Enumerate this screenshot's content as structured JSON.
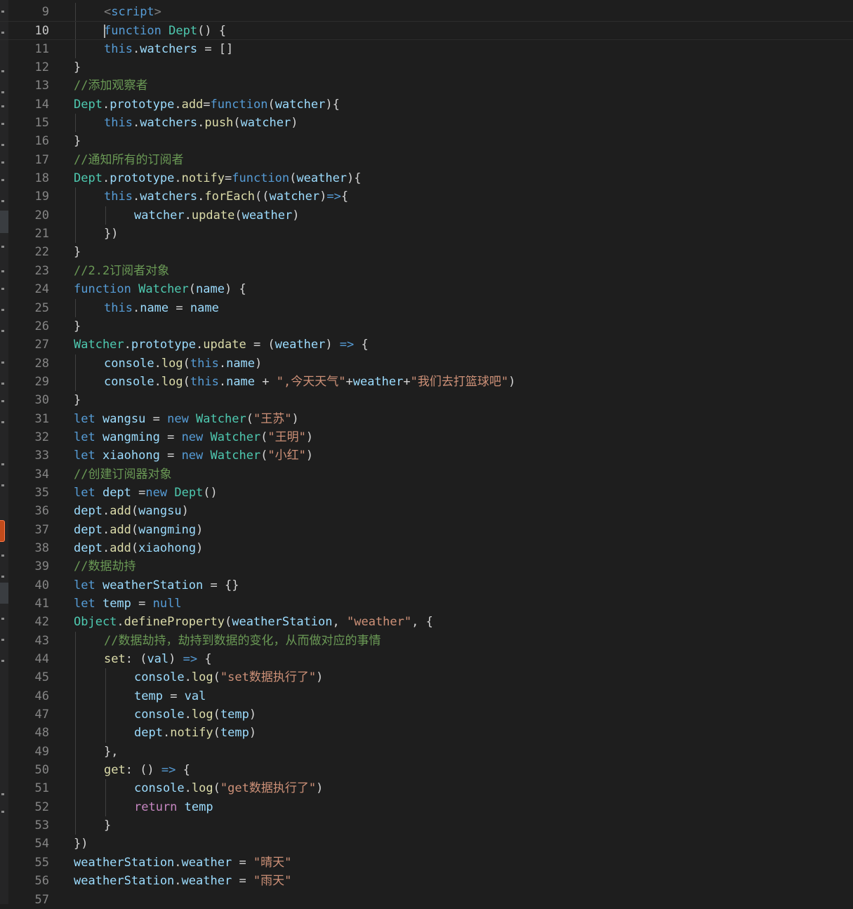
{
  "editor": {
    "first_line": 9,
    "current_line": 10,
    "lines": [
      {
        "n": "9",
        "indent": 1,
        "tokens": [
          [
            "tag",
            "<"
          ],
          [
            "kw",
            "script"
          ],
          [
            "tag",
            ">"
          ]
        ]
      },
      {
        "n": "10",
        "indent": 1,
        "tokens": [
          [
            "kw",
            "function "
          ],
          [
            "type",
            "Dept"
          ],
          [
            "plain",
            "() {"
          ]
        ],
        "current": true
      },
      {
        "n": "11",
        "indent": 1,
        "tokens": [
          [
            "kw",
            "this"
          ],
          [
            "plain",
            "."
          ],
          [
            "var",
            "watchers"
          ],
          [
            "plain",
            " = []"
          ]
        ]
      },
      {
        "n": "12",
        "indent": 0,
        "tokens": [
          [
            "plain",
            "}"
          ]
        ]
      },
      {
        "n": "13",
        "indent": 0,
        "tokens": [
          [
            "cmt",
            "//添加观察者"
          ]
        ]
      },
      {
        "n": "14",
        "indent": 0,
        "tokens": [
          [
            "type",
            "Dept"
          ],
          [
            "plain",
            "."
          ],
          [
            "var",
            "prototype"
          ],
          [
            "plain",
            "."
          ],
          [
            "fn",
            "add"
          ],
          [
            "plain",
            "="
          ],
          [
            "kw",
            "function"
          ],
          [
            "plain",
            "("
          ],
          [
            "var",
            "watcher"
          ],
          [
            "plain",
            "){"
          ]
        ]
      },
      {
        "n": "15",
        "indent": 1,
        "tokens": [
          [
            "kw",
            "this"
          ],
          [
            "plain",
            "."
          ],
          [
            "var",
            "watchers"
          ],
          [
            "plain",
            "."
          ],
          [
            "fn",
            "push"
          ],
          [
            "plain",
            "("
          ],
          [
            "var",
            "watcher"
          ],
          [
            "plain",
            ")"
          ]
        ]
      },
      {
        "n": "16",
        "indent": 0,
        "tokens": [
          [
            "plain",
            "}"
          ]
        ]
      },
      {
        "n": "17",
        "indent": 0,
        "tokens": [
          [
            "cmt",
            "//通知所有的订阅者"
          ]
        ]
      },
      {
        "n": "18",
        "indent": 0,
        "tokens": [
          [
            "type",
            "Dept"
          ],
          [
            "plain",
            "."
          ],
          [
            "var",
            "prototype"
          ],
          [
            "plain",
            "."
          ],
          [
            "fn",
            "notify"
          ],
          [
            "plain",
            "="
          ],
          [
            "kw",
            "function"
          ],
          [
            "plain",
            "("
          ],
          [
            "var",
            "weather"
          ],
          [
            "plain",
            "){"
          ]
        ]
      },
      {
        "n": "19",
        "indent": 1,
        "tokens": [
          [
            "kw",
            "this"
          ],
          [
            "plain",
            "."
          ],
          [
            "var",
            "watchers"
          ],
          [
            "plain",
            "."
          ],
          [
            "fn",
            "forEach"
          ],
          [
            "plain",
            "(("
          ],
          [
            "var",
            "watcher"
          ],
          [
            "plain",
            ")"
          ],
          [
            "kw",
            "=>"
          ],
          [
            "plain",
            "{"
          ]
        ]
      },
      {
        "n": "20",
        "indent": 2,
        "tokens": [
          [
            "var",
            "watcher"
          ],
          [
            "plain",
            "."
          ],
          [
            "fn",
            "update"
          ],
          [
            "plain",
            "("
          ],
          [
            "var",
            "weather"
          ],
          [
            "plain",
            ")"
          ]
        ]
      },
      {
        "n": "21",
        "indent": 1,
        "tokens": [
          [
            "plain",
            "})"
          ]
        ]
      },
      {
        "n": "22",
        "indent": 0,
        "tokens": [
          [
            "plain",
            "}"
          ]
        ]
      },
      {
        "n": "23",
        "indent": 0,
        "tokens": [
          [
            "cmt",
            "//2.2订阅者对象"
          ]
        ]
      },
      {
        "n": "24",
        "indent": 0,
        "tokens": [
          [
            "kw",
            "function "
          ],
          [
            "type",
            "Watcher"
          ],
          [
            "plain",
            "("
          ],
          [
            "var",
            "name"
          ],
          [
            "plain",
            ") {"
          ]
        ]
      },
      {
        "n": "25",
        "indent": 1,
        "tokens": [
          [
            "kw",
            "this"
          ],
          [
            "plain",
            "."
          ],
          [
            "var",
            "name"
          ],
          [
            "plain",
            " = "
          ],
          [
            "var",
            "name"
          ]
        ]
      },
      {
        "n": "26",
        "indent": 0,
        "tokens": [
          [
            "plain",
            "}"
          ]
        ]
      },
      {
        "n": "27",
        "indent": 0,
        "tokens": [
          [
            "type",
            "Watcher"
          ],
          [
            "plain",
            "."
          ],
          [
            "var",
            "prototype"
          ],
          [
            "plain",
            "."
          ],
          [
            "fn",
            "update"
          ],
          [
            "plain",
            " = ("
          ],
          [
            "var",
            "weather"
          ],
          [
            "plain",
            ") "
          ],
          [
            "kw",
            "=>"
          ],
          [
            "plain",
            " {"
          ]
        ]
      },
      {
        "n": "28",
        "indent": 1,
        "tokens": [
          [
            "var",
            "console"
          ],
          [
            "plain",
            "."
          ],
          [
            "fn",
            "log"
          ],
          [
            "plain",
            "("
          ],
          [
            "kw",
            "this"
          ],
          [
            "plain",
            "."
          ],
          [
            "var",
            "name"
          ],
          [
            "plain",
            ")"
          ]
        ]
      },
      {
        "n": "29",
        "indent": 1,
        "tokens": [
          [
            "var",
            "console"
          ],
          [
            "plain",
            "."
          ],
          [
            "fn",
            "log"
          ],
          [
            "plain",
            "("
          ],
          [
            "kw",
            "this"
          ],
          [
            "plain",
            "."
          ],
          [
            "var",
            "name"
          ],
          [
            "plain",
            " + "
          ],
          [
            "str",
            "\",今天天气\""
          ],
          [
            "plain",
            "+"
          ],
          [
            "var",
            "weather"
          ],
          [
            "plain",
            "+"
          ],
          [
            "str",
            "\"我们去打篮球吧\""
          ],
          [
            "plain",
            ")"
          ]
        ]
      },
      {
        "n": "30",
        "indent": 0,
        "tokens": [
          [
            "plain",
            "}"
          ]
        ]
      },
      {
        "n": "31",
        "indent": 0,
        "tokens": [
          [
            "kw",
            "let "
          ],
          [
            "var",
            "wangsu"
          ],
          [
            "plain",
            " = "
          ],
          [
            "kw",
            "new "
          ],
          [
            "type",
            "Watcher"
          ],
          [
            "plain",
            "("
          ],
          [
            "str",
            "\"王苏\""
          ],
          [
            "plain",
            ")"
          ]
        ]
      },
      {
        "n": "32",
        "indent": 0,
        "tokens": [
          [
            "kw",
            "let "
          ],
          [
            "var",
            "wangming"
          ],
          [
            "plain",
            " = "
          ],
          [
            "kw",
            "new "
          ],
          [
            "type",
            "Watcher"
          ],
          [
            "plain",
            "("
          ],
          [
            "str",
            "\"王明\""
          ],
          [
            "plain",
            ")"
          ]
        ]
      },
      {
        "n": "33",
        "indent": 0,
        "tokens": [
          [
            "kw",
            "let "
          ],
          [
            "var",
            "xiaohong"
          ],
          [
            "plain",
            " = "
          ],
          [
            "kw",
            "new "
          ],
          [
            "type",
            "Watcher"
          ],
          [
            "plain",
            "("
          ],
          [
            "str",
            "\"小红\""
          ],
          [
            "plain",
            ")"
          ]
        ]
      },
      {
        "n": "34",
        "indent": 0,
        "tokens": [
          [
            "cmt",
            "//创建订阅器对象"
          ]
        ]
      },
      {
        "n": "35",
        "indent": 0,
        "tokens": [
          [
            "kw",
            "let "
          ],
          [
            "var",
            "dept"
          ],
          [
            "plain",
            " ="
          ],
          [
            "kw",
            "new "
          ],
          [
            "type",
            "Dept"
          ],
          [
            "plain",
            "()"
          ]
        ]
      },
      {
        "n": "36",
        "indent": 0,
        "tokens": [
          [
            "var",
            "dept"
          ],
          [
            "plain",
            "."
          ],
          [
            "fn",
            "add"
          ],
          [
            "plain",
            "("
          ],
          [
            "var",
            "wangsu"
          ],
          [
            "plain",
            ")"
          ]
        ]
      },
      {
        "n": "37",
        "indent": 0,
        "tokens": [
          [
            "var",
            "dept"
          ],
          [
            "plain",
            "."
          ],
          [
            "fn",
            "add"
          ],
          [
            "plain",
            "("
          ],
          [
            "var",
            "wangming"
          ],
          [
            "plain",
            ")"
          ]
        ]
      },
      {
        "n": "38",
        "indent": 0,
        "tokens": [
          [
            "var",
            "dept"
          ],
          [
            "plain",
            "."
          ],
          [
            "fn",
            "add"
          ],
          [
            "plain",
            "("
          ],
          [
            "var",
            "xiaohong"
          ],
          [
            "plain",
            ")"
          ]
        ]
      },
      {
        "n": "39",
        "indent": 0,
        "tokens": [
          [
            "cmt",
            "//数据劫持"
          ]
        ]
      },
      {
        "n": "40",
        "indent": 0,
        "tokens": [
          [
            "kw",
            "let "
          ],
          [
            "var",
            "weatherStation"
          ],
          [
            "plain",
            " = {}"
          ]
        ]
      },
      {
        "n": "41",
        "indent": 0,
        "tokens": [
          [
            "kw",
            "let "
          ],
          [
            "var",
            "temp"
          ],
          [
            "plain",
            " = "
          ],
          [
            "kw",
            "null"
          ]
        ]
      },
      {
        "n": "42",
        "indent": 0,
        "tokens": [
          [
            "type",
            "Object"
          ],
          [
            "plain",
            "."
          ],
          [
            "fn",
            "defineProperty"
          ],
          [
            "plain",
            "("
          ],
          [
            "var",
            "weatherStation"
          ],
          [
            "plain",
            ", "
          ],
          [
            "str",
            "\"weather\""
          ],
          [
            "plain",
            ", {"
          ]
        ]
      },
      {
        "n": "43",
        "indent": 1,
        "tokens": [
          [
            "cmt",
            "//数据劫持，劫持到数据的变化，从而做对应的事情"
          ]
        ]
      },
      {
        "n": "44",
        "indent": 1,
        "tokens": [
          [
            "fn",
            "set"
          ],
          [
            "plain",
            ": ("
          ],
          [
            "var",
            "val"
          ],
          [
            "plain",
            ") "
          ],
          [
            "kw",
            "=>"
          ],
          [
            "plain",
            " {"
          ]
        ]
      },
      {
        "n": "45",
        "indent": 2,
        "tokens": [
          [
            "var",
            "console"
          ],
          [
            "plain",
            "."
          ],
          [
            "fn",
            "log"
          ],
          [
            "plain",
            "("
          ],
          [
            "str",
            "\"set数据执行了\""
          ],
          [
            "plain",
            ")"
          ]
        ]
      },
      {
        "n": "46",
        "indent": 2,
        "tokens": [
          [
            "var",
            "temp"
          ],
          [
            "plain",
            " = "
          ],
          [
            "var",
            "val"
          ]
        ]
      },
      {
        "n": "47",
        "indent": 2,
        "tokens": [
          [
            "var",
            "console"
          ],
          [
            "plain",
            "."
          ],
          [
            "fn",
            "log"
          ],
          [
            "plain",
            "("
          ],
          [
            "var",
            "temp"
          ],
          [
            "plain",
            ")"
          ]
        ]
      },
      {
        "n": "48",
        "indent": 2,
        "tokens": [
          [
            "var",
            "dept"
          ],
          [
            "plain",
            "."
          ],
          [
            "fn",
            "notify"
          ],
          [
            "plain",
            "("
          ],
          [
            "var",
            "temp"
          ],
          [
            "plain",
            ")"
          ]
        ]
      },
      {
        "n": "49",
        "indent": 1,
        "tokens": [
          [
            "plain",
            "},"
          ]
        ]
      },
      {
        "n": "50",
        "indent": 1,
        "tokens": [
          [
            "fn",
            "get"
          ],
          [
            "plain",
            ": () "
          ],
          [
            "kw",
            "=>"
          ],
          [
            "plain",
            " {"
          ]
        ]
      },
      {
        "n": "51",
        "indent": 2,
        "tokens": [
          [
            "var",
            "console"
          ],
          [
            "plain",
            "."
          ],
          [
            "fn",
            "log"
          ],
          [
            "plain",
            "("
          ],
          [
            "str",
            "\"get数据执行了\""
          ],
          [
            "plain",
            ")"
          ]
        ]
      },
      {
        "n": "52",
        "indent": 2,
        "tokens": [
          [
            "ctl",
            "return "
          ],
          [
            "var",
            "temp"
          ]
        ]
      },
      {
        "n": "53",
        "indent": 1,
        "tokens": [
          [
            "plain",
            "}"
          ]
        ]
      },
      {
        "n": "54",
        "indent": 0,
        "tokens": [
          [
            "plain",
            "})"
          ]
        ]
      },
      {
        "n": "55",
        "indent": 0,
        "tokens": [
          [
            "var",
            "weatherStation"
          ],
          [
            "plain",
            "."
          ],
          [
            "var",
            "weather"
          ],
          [
            "plain",
            " = "
          ],
          [
            "str",
            "\"晴天\""
          ]
        ]
      },
      {
        "n": "56",
        "indent": 0,
        "tokens": [
          [
            "var",
            "weatherStation"
          ],
          [
            "plain",
            "."
          ],
          [
            "var",
            "weather"
          ],
          [
            "plain",
            " = "
          ],
          [
            "str",
            "\"雨天\""
          ]
        ]
      },
      {
        "n": "57",
        "indent": 0,
        "tokens": []
      }
    ]
  }
}
